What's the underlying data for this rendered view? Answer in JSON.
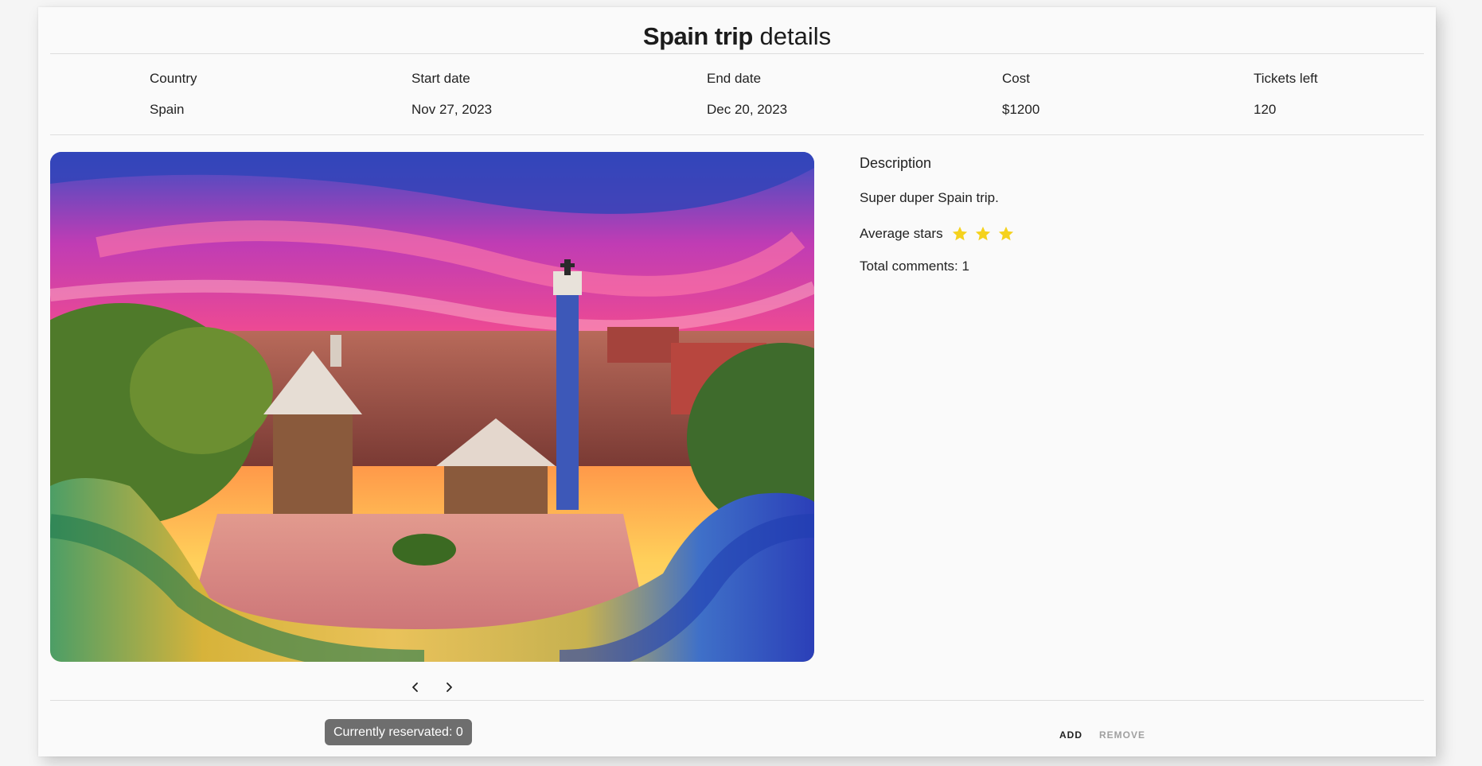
{
  "title": {
    "bold": "Spain trip",
    "light": "details"
  },
  "info": {
    "headers": [
      "Country",
      "Start date",
      "End date",
      "Cost",
      "Tickets left"
    ],
    "values": [
      "Spain",
      "Nov 27, 2023",
      "Dec 20, 2023",
      "$1200",
      "120"
    ]
  },
  "gallery": {
    "image_alt": "Park Güell, Barcelona at sunset",
    "prev_icon": "chevron-left-icon",
    "next_icon": "chevron-right-icon"
  },
  "description": {
    "heading": "Description",
    "text": "Super duper Spain trip.",
    "stars_label": "Average stars",
    "stars": 3,
    "star_color": "#f5d21d",
    "comments": "Total comments: 1"
  },
  "reservation": {
    "badge": "Currently reservated: 0",
    "add_label": "ADD",
    "remove_label": "REMOVE",
    "badge_color": "#6e6e6e"
  }
}
